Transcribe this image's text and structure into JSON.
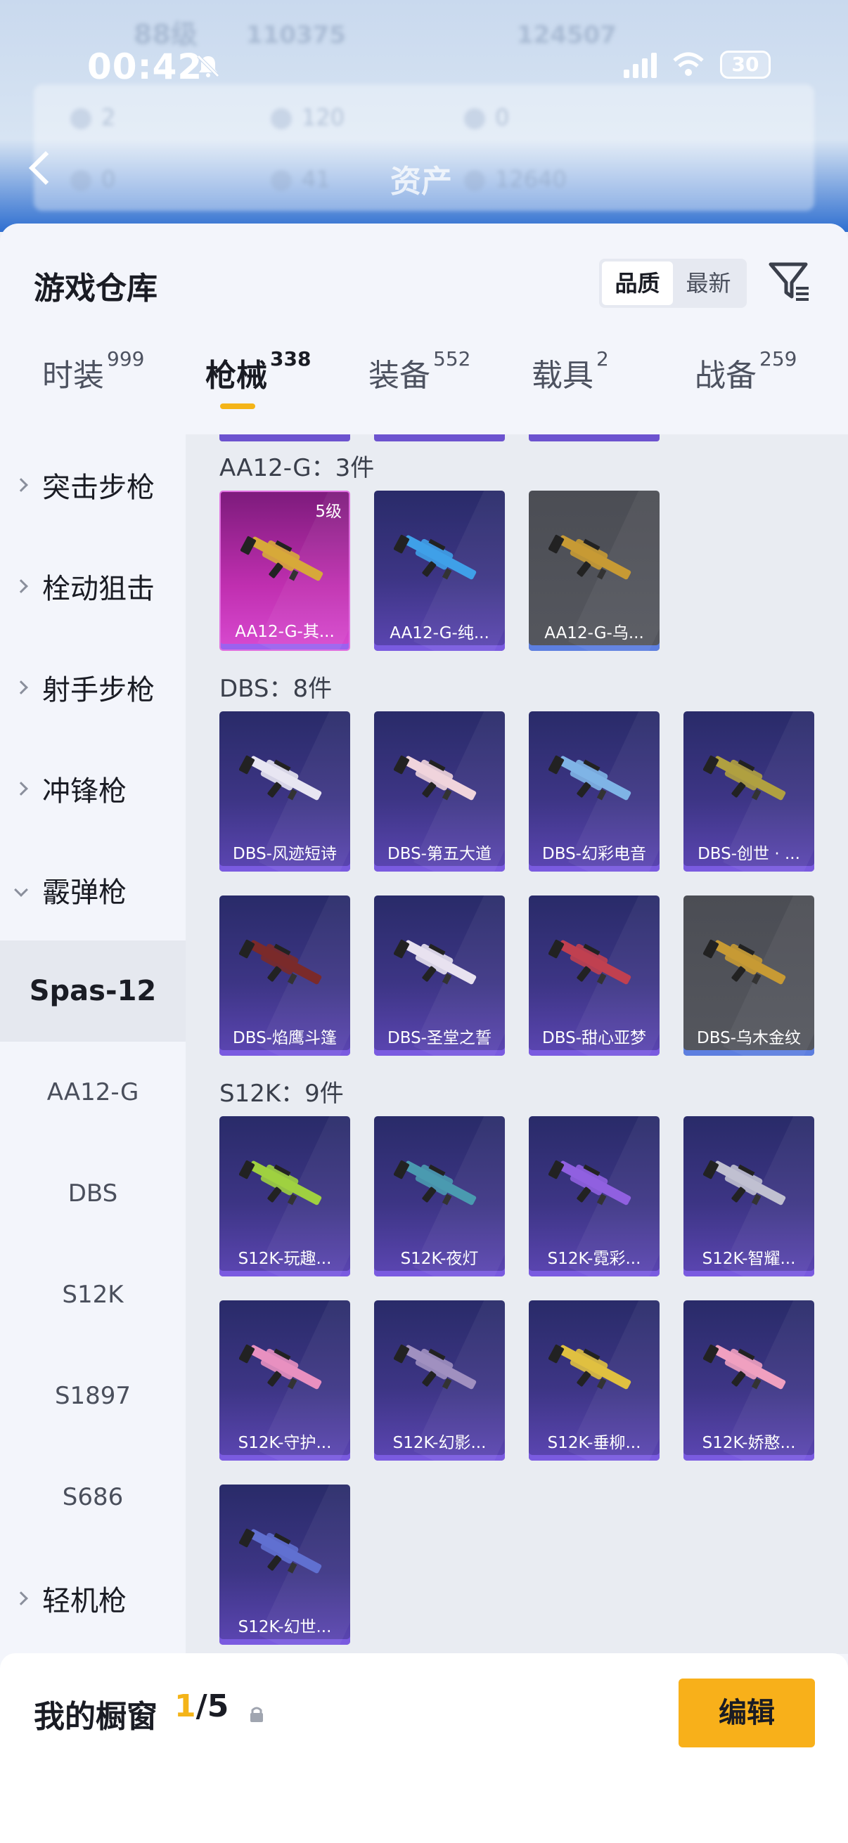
{
  "status_bar": {
    "time": "00:42",
    "battery": "30"
  },
  "backdrop": {
    "title": "资产",
    "level_text": "88级",
    "score_a": "110375",
    "score_b": "124507",
    "stats": [
      "2",
      "120",
      "0",
      "0",
      "41",
      "12640"
    ]
  },
  "header": {
    "title": "游戏仓库",
    "sort_options": [
      "品质",
      "最新"
    ]
  },
  "tabs": [
    {
      "label": "时装",
      "count": "999"
    },
    {
      "label": "枪械",
      "count": "338"
    },
    {
      "label": "装备",
      "count": "552"
    },
    {
      "label": "载具",
      "count": "2"
    },
    {
      "label": "战备",
      "count": "259"
    }
  ],
  "sidebar": {
    "categories": [
      "突击步枪",
      "栓动狙击",
      "射手步枪",
      "冲锋枪",
      "霰弹枪"
    ],
    "sub_items": [
      "Spas-12",
      "AA12-G",
      "DBS",
      "S12K",
      "S1897",
      "S686"
    ],
    "last_category": "轻机枪"
  },
  "groups": [
    {
      "title": "AA12-G：3件",
      "items": [
        {
          "name": "AA12-G-其...",
          "rarity": "pink",
          "level": "5级",
          "gun_color": "#d7a83a"
        },
        {
          "name": "AA12-G-纯...",
          "rarity": "purple",
          "gun_color": "#3fa0e8"
        },
        {
          "name": "AA12-G-乌...",
          "rarity": "gray",
          "gun_color": "#c79a34"
        }
      ]
    },
    {
      "title": "DBS：8件",
      "items": [
        {
          "name": "DBS-风迹短诗",
          "rarity": "purple",
          "gun_color": "#e8e6f2"
        },
        {
          "name": "DBS-第五大道",
          "rarity": "purple",
          "gun_color": "#f0d4dc"
        },
        {
          "name": "DBS-幻彩电音",
          "rarity": "purple",
          "gun_color": "#7fb4e6"
        },
        {
          "name": "DBS-创世 · ...",
          "rarity": "purple",
          "gun_color": "#b0a040"
        },
        {
          "name": "DBS-焰鹰斗篷",
          "rarity": "purple",
          "gun_color": "#7a2a2a"
        },
        {
          "name": "DBS-圣堂之誓",
          "rarity": "purple",
          "gun_color": "#e8e2f0"
        },
        {
          "name": "DBS-甜心亚梦",
          "rarity": "purple",
          "gun_color": "#c04050"
        },
        {
          "name": "DBS-乌木金纹",
          "rarity": "gray",
          "gun_color": "#c79a34"
        }
      ]
    },
    {
      "title": "S12K：9件",
      "items": [
        {
          "name": "S12K-玩趣...",
          "rarity": "purple",
          "gun_color": "#9fd040"
        },
        {
          "name": "S12K-夜灯",
          "rarity": "purple",
          "gun_color": "#4a9ab0"
        },
        {
          "name": "S12K-霓彩...",
          "rarity": "purple",
          "gun_color": "#9060e0"
        },
        {
          "name": "S12K-智耀...",
          "rarity": "purple",
          "gun_color": "#c0c0d0"
        },
        {
          "name": "S12K-守护...",
          "rarity": "purple",
          "gun_color": "#e890c0"
        },
        {
          "name": "S12K-幻影...",
          "rarity": "purple",
          "gun_color": "#a090c0"
        },
        {
          "name": "S12K-垂柳...",
          "rarity": "purple",
          "gun_color": "#e0c040"
        },
        {
          "name": "S12K-娇憨...",
          "rarity": "purple",
          "gun_color": "#f0a0c0"
        },
        {
          "name": "S12K-幻世...",
          "rarity": "purple",
          "gun_color": "#6070d0"
        }
      ]
    }
  ],
  "showcase": {
    "title": "我的橱窗",
    "current": "1",
    "total": "/5",
    "edit_label": "编辑"
  },
  "colors": {
    "accent": "#f4b418",
    "card_purple": "#3d3585",
    "card_pink": "#c02fb0",
    "card_gray": "#55575e"
  },
  "icons": [
    "back-chevron-icon",
    "mute-bell-icon",
    "signal-icon",
    "wifi-icon",
    "filter-icon",
    "share-icon",
    "lock-icon"
  ]
}
